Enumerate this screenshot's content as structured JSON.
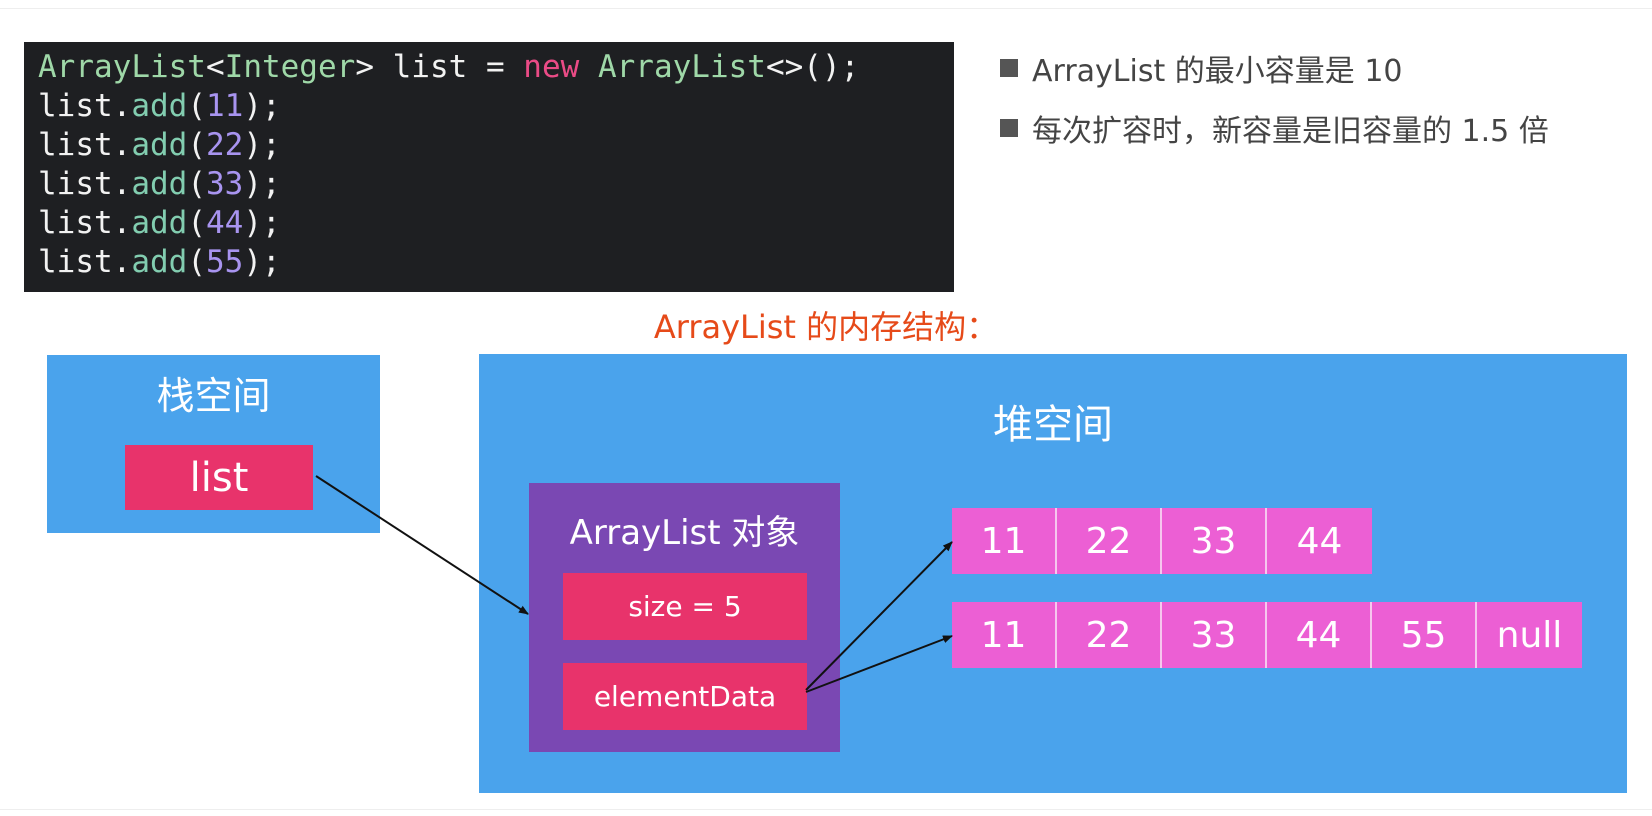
{
  "code": {
    "lines": [
      [
        {
          "text": "ArrayList",
          "kind": "type"
        },
        {
          "text": "<",
          "kind": "plain"
        },
        {
          "text": "Integer",
          "kind": "type"
        },
        {
          "text": "> list = ",
          "kind": "plain"
        },
        {
          "text": "new",
          "kind": "kw"
        },
        {
          "text": " ",
          "kind": "plain"
        },
        {
          "text": "ArrayList",
          "kind": "type"
        },
        {
          "text": "<>();",
          "kind": "plain"
        }
      ],
      [
        {
          "text": "list.",
          "kind": "plain"
        },
        {
          "text": "add",
          "kind": "meth"
        },
        {
          "text": "(",
          "kind": "plain"
        },
        {
          "text": "11",
          "kind": "num"
        },
        {
          "text": ");",
          "kind": "plain"
        }
      ],
      [
        {
          "text": "list.",
          "kind": "plain"
        },
        {
          "text": "add",
          "kind": "meth"
        },
        {
          "text": "(",
          "kind": "plain"
        },
        {
          "text": "22",
          "kind": "num"
        },
        {
          "text": ");",
          "kind": "plain"
        }
      ],
      [
        {
          "text": "list.",
          "kind": "plain"
        },
        {
          "text": "add",
          "kind": "meth"
        },
        {
          "text": "(",
          "kind": "plain"
        },
        {
          "text": "33",
          "kind": "num"
        },
        {
          "text": ");",
          "kind": "plain"
        }
      ],
      [
        {
          "text": "list.",
          "kind": "plain"
        },
        {
          "text": "add",
          "kind": "meth"
        },
        {
          "text": "(",
          "kind": "plain"
        },
        {
          "text": "44",
          "kind": "num"
        },
        {
          "text": ");",
          "kind": "plain"
        }
      ],
      [
        {
          "text": "list.",
          "kind": "plain"
        },
        {
          "text": "add",
          "kind": "meth"
        },
        {
          "text": "(",
          "kind": "plain"
        },
        {
          "text": "55",
          "kind": "num"
        },
        {
          "text": ");",
          "kind": "plain"
        }
      ]
    ]
  },
  "notes": {
    "items": [
      "ArrayList 的最小容量是 10",
      "每次扩容时，新容量是旧容量的 1.5 倍"
    ]
  },
  "caption": "ArrayList 的内存结构：",
  "stack": {
    "title": "栈空间",
    "variable": "list"
  },
  "heap": {
    "title": "堆空间",
    "object_title": "ArrayList 对象",
    "fields": {
      "size": "size = 5",
      "element_data": "elementData"
    },
    "old_array": [
      "11",
      "22",
      "33",
      "44"
    ],
    "new_array": [
      "11",
      "22",
      "33",
      "44",
      "55",
      "null"
    ]
  },
  "colors": {
    "code_bg": "#1e1f22",
    "panel_blue": "#4aa3ec",
    "object_purple": "#7a48b3",
    "field_pink": "#e8336b",
    "cell_magenta": "#ec5fd4",
    "caption_red": "#e64a19"
  }
}
